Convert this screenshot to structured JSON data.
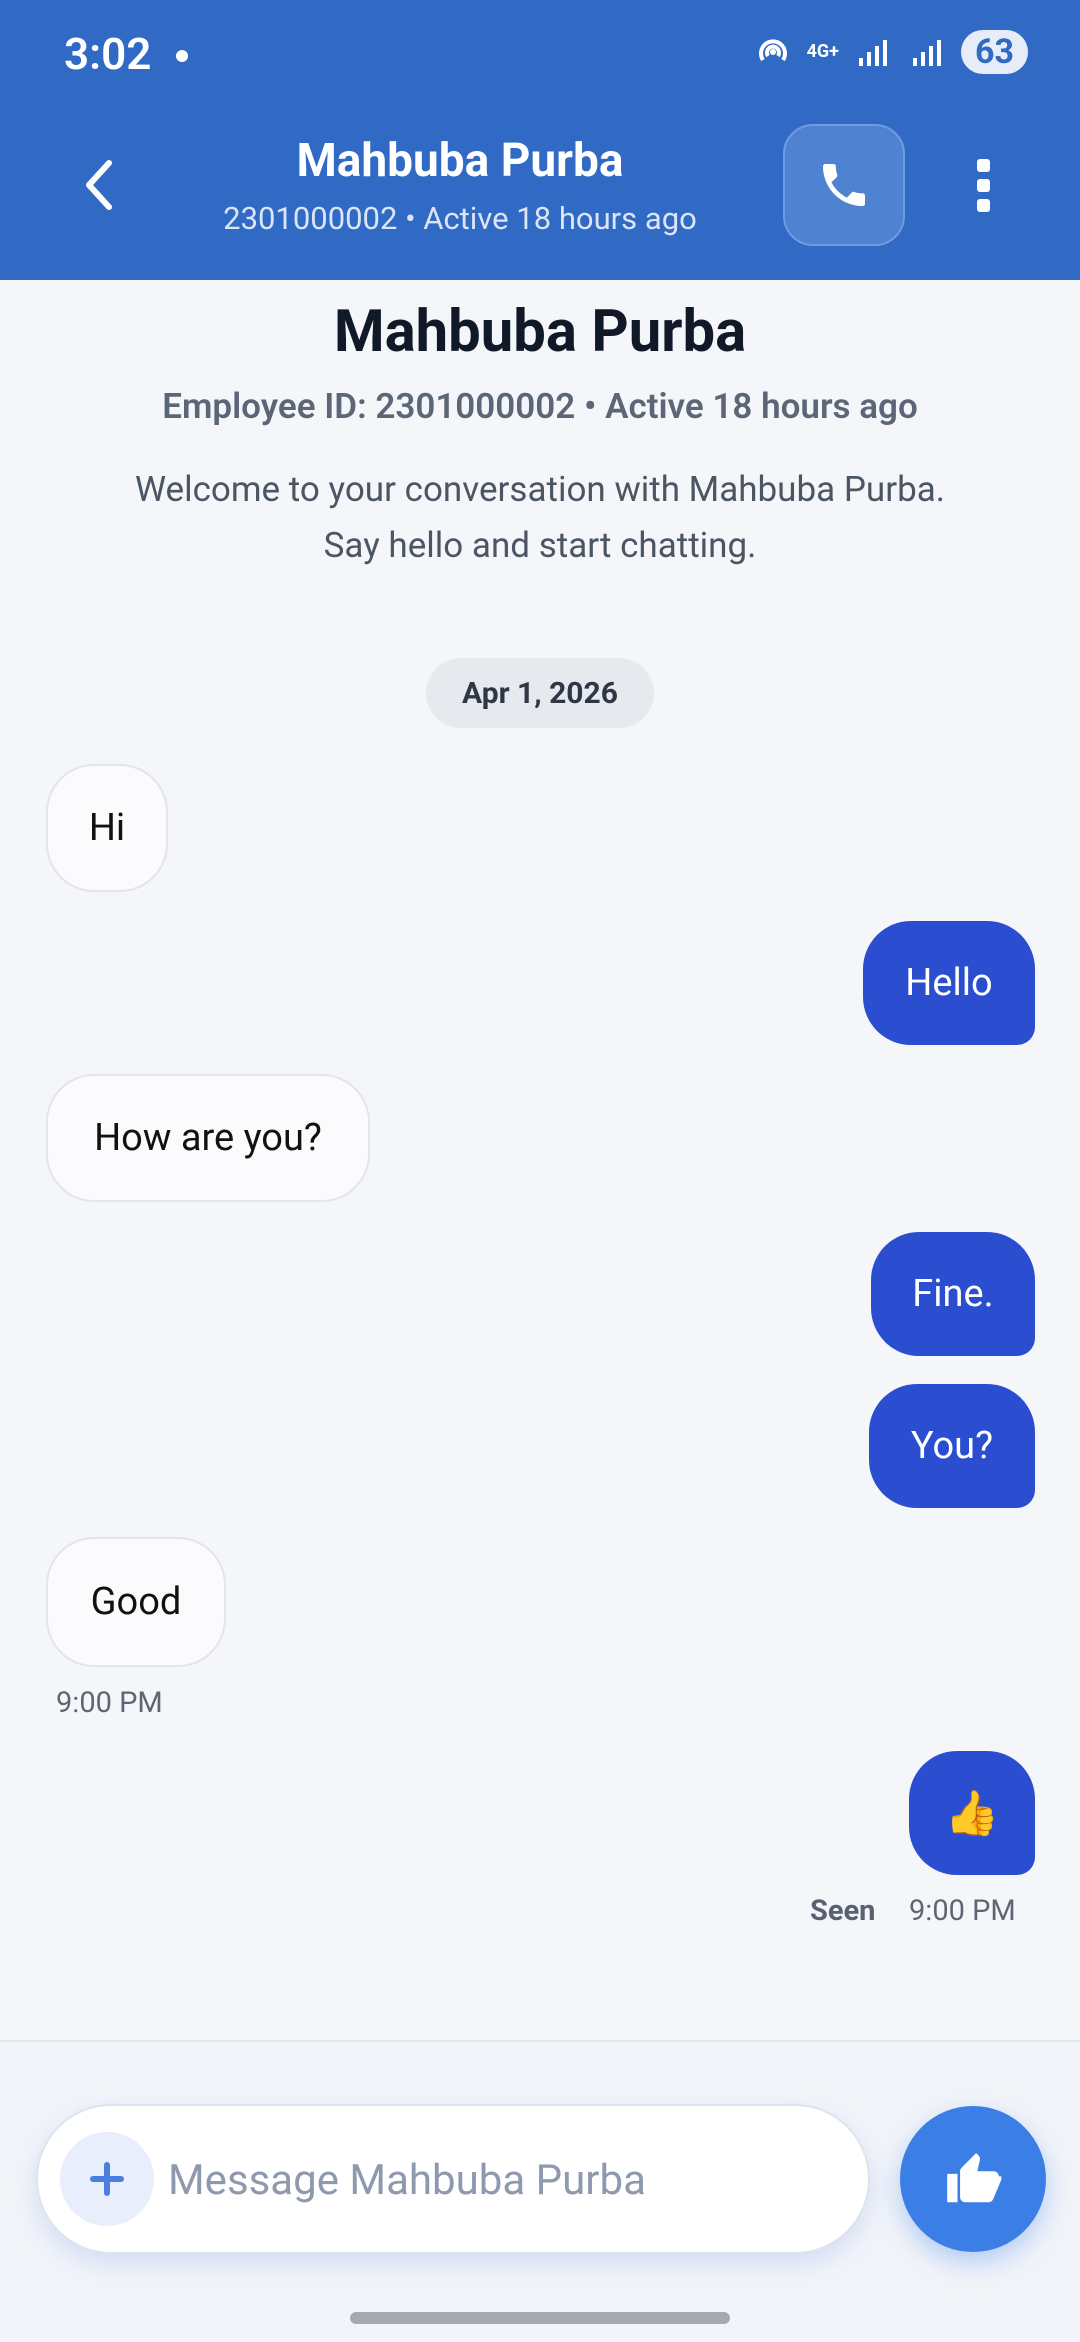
{
  "status_bar": {
    "time": "3:02",
    "network": "4G+",
    "battery": "63"
  },
  "header": {
    "name": "Mahbuba Purba",
    "subtitle": "2301000002 • Active 18 hours ago"
  },
  "intro": {
    "name": "Mahbuba Purba",
    "subtitle": "Employee ID: 2301000002 • Active 18 hours ago",
    "welcome_line1": "Welcome to your conversation with Mahbuba Purba.",
    "welcome_line2": "Say hello and start chatting."
  },
  "date_label": "Apr 1, 2026",
  "messages": [
    {
      "text": "Hi",
      "direction": "incoming"
    },
    {
      "text": "Hello",
      "direction": "outgoing"
    },
    {
      "text": "How are you?",
      "direction": "incoming"
    },
    {
      "text": "Fine.",
      "direction": "outgoing"
    },
    {
      "text": "You?",
      "direction": "outgoing"
    },
    {
      "text": "Good",
      "direction": "incoming",
      "time": "9:00 PM"
    },
    {
      "text": "👍",
      "direction": "outgoing",
      "status": "Seen",
      "time": "9:00 PM"
    }
  ],
  "composer": {
    "placeholder": "Message Mahbuba Purba"
  },
  "colors": {
    "header_bg": "#306ac4",
    "outgoing_bubble": "#2a4ecf",
    "send_button": "#3b7ee6"
  }
}
